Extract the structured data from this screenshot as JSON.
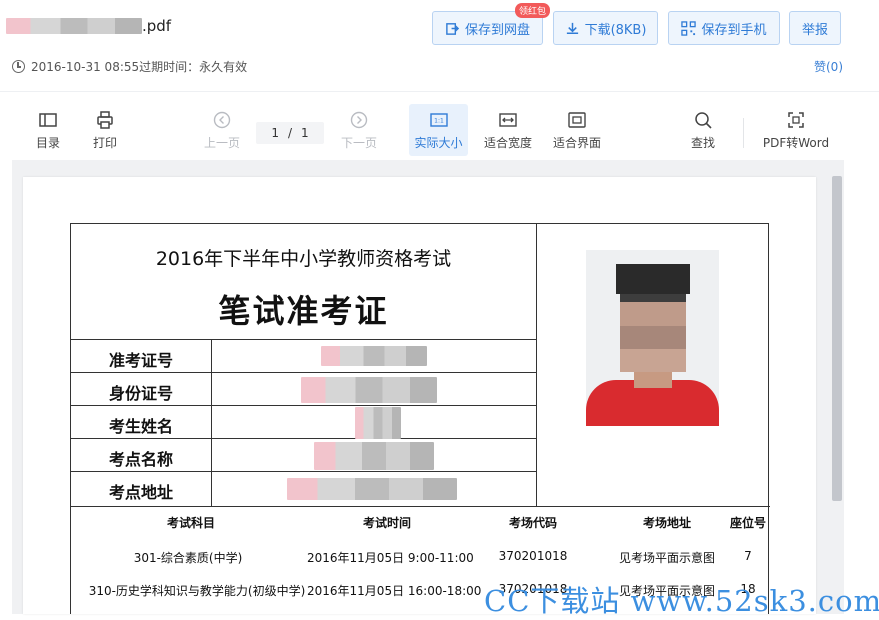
{
  "file": {
    "extension": ".pdf",
    "date": "2016-10-31 08:55",
    "expiry_label": "过期时间：",
    "expiry_value": "永久有效",
    "like_label": "赞(0)"
  },
  "buttons": {
    "save_cloud": "保存到网盘",
    "save_cloud_badge": "领红包",
    "download": "下载(8KB)",
    "save_phone": "保存到手机",
    "report": "举报"
  },
  "toolbar": {
    "toc": "目录",
    "print": "打印",
    "prev": "上一页",
    "page_current": "1",
    "page_sep": "/",
    "page_total": "1",
    "next": "下一页",
    "actual_size": "实际大小",
    "actual_size_glyph": "1:1",
    "fit_width": "适合宽度",
    "fit_page": "适合界面",
    "find": "查找",
    "pdf_to_word": "PDF转Word"
  },
  "ticket": {
    "title": "2016年下半年中小学教师资格考试",
    "subtitle": "笔试准考证",
    "rows": [
      "准考证号",
      "身份证号",
      "考生姓名",
      "考点名称",
      "考点地址"
    ],
    "headers": [
      "考试科目",
      "考试时间",
      "考场代码",
      "考场地址",
      "座位号"
    ],
    "exams": [
      [
        "301-综合素质(中学)",
        "2016年11月05日 9:00-11:00",
        "370201018",
        "见考场平面示意图",
        "7"
      ],
      [
        "310-历史学科知识与教学能力(初级中学)",
        "2016年11月05日 16:00-18:00",
        "370201018",
        "见考场平面示意图",
        "18"
      ]
    ]
  },
  "watermark": "CC下载站 www.52sk3.com"
}
